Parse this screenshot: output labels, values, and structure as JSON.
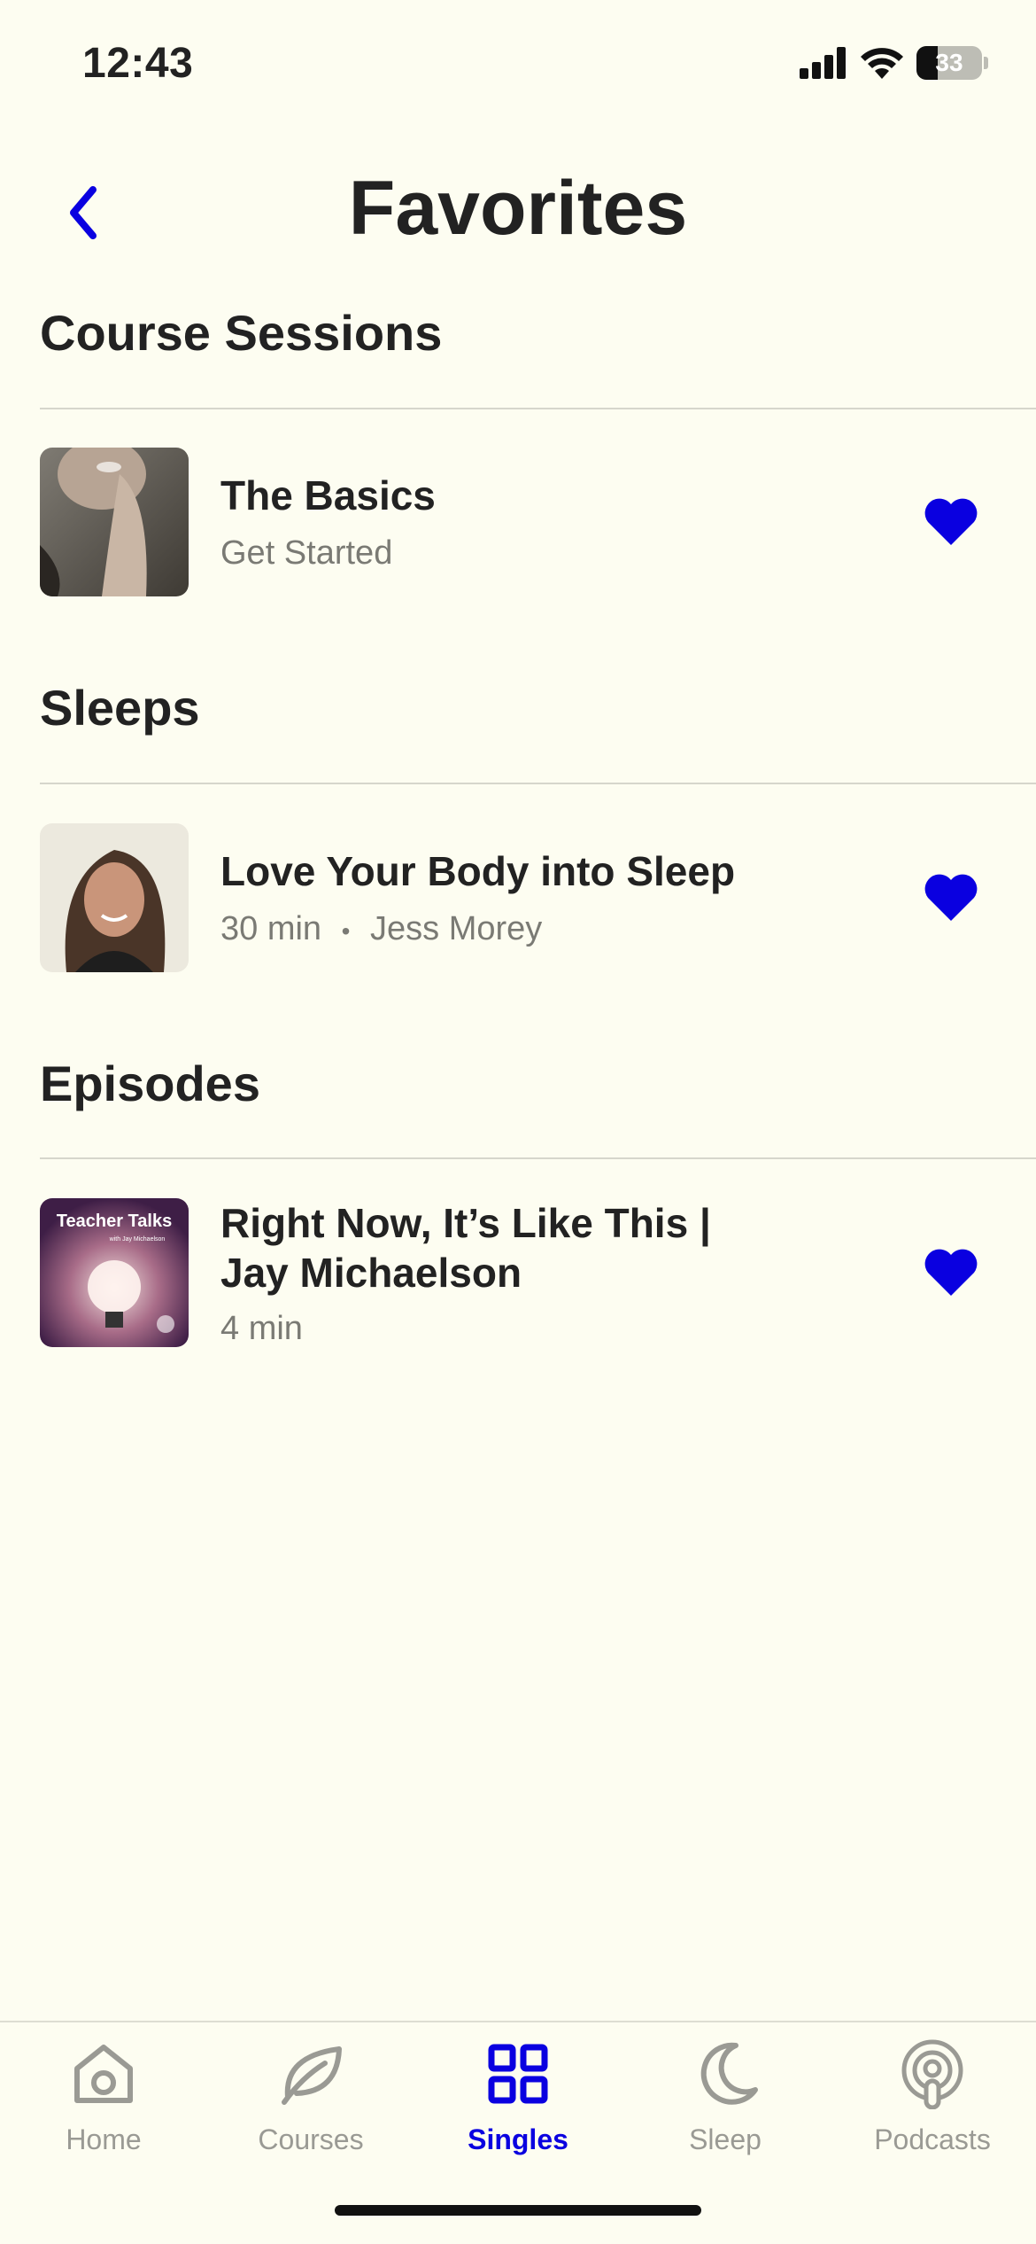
{
  "status_bar": {
    "time": "12:43",
    "battery": "33"
  },
  "header": {
    "title": "Favorites"
  },
  "sections": [
    {
      "heading": "Course Sessions",
      "item": {
        "title": "The Basics",
        "subtitle": "Get Started"
      }
    },
    {
      "heading": "Sleeps",
      "item": {
        "title": "Love Your Body into Sleep",
        "duration": "30 min",
        "separator": "•",
        "author": "Jess Morey"
      }
    },
    {
      "heading": "Episodes",
      "item": {
        "title_line1": "Right Now, It’s Like This |",
        "title_line2": "Jay Michaelson",
        "subtitle": "4 min",
        "thumb_text": "Teacher Talks",
        "thumb_subtext": "with Jay Michaelson"
      }
    }
  ],
  "tabbar": {
    "tabs": [
      {
        "label": "Home",
        "icon": "home-icon"
      },
      {
        "label": "Courses",
        "icon": "leaf-icon"
      },
      {
        "label": "Singles",
        "icon": "grid-icon",
        "active": true
      },
      {
        "label": "Sleep",
        "icon": "moon-icon"
      },
      {
        "label": "Podcasts",
        "icon": "podcast-icon"
      }
    ]
  },
  "colors": {
    "accent": "#0A00E0",
    "background": "#FDFDF1",
    "text": "#222222",
    "muted": "#7A7A74"
  }
}
